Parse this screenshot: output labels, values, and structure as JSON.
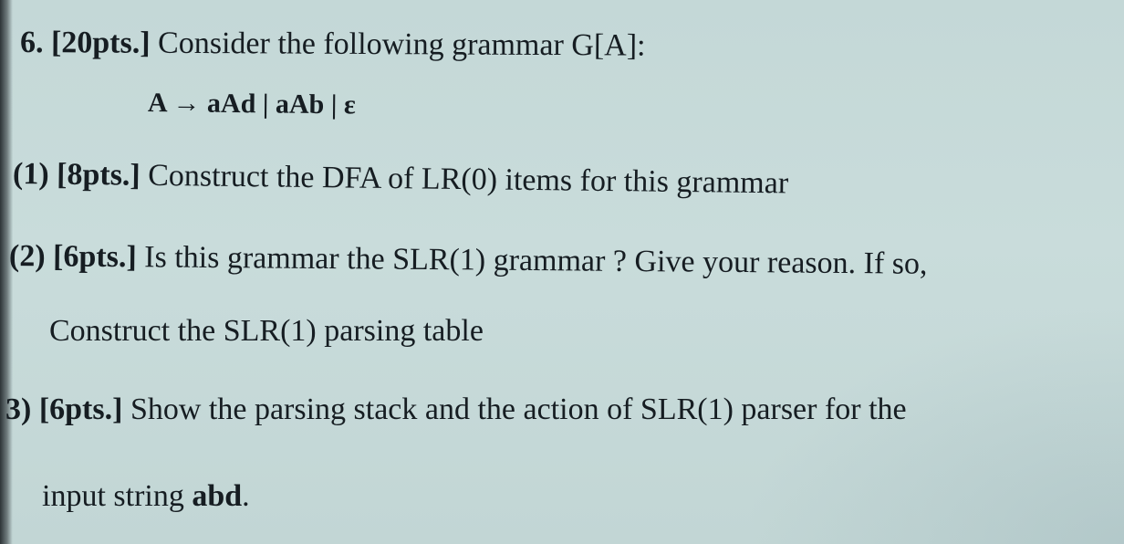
{
  "question": {
    "number_points": "6. [20pts.]",
    "intro": " Consider the following grammar G[A]:",
    "grammar_lhs": "A",
    "grammar_arrow": "→",
    "grammar_rhs": "aAd | aAb | ε"
  },
  "parts": [
    {
      "points": "(1) [8pts.]",
      "text": " Construct the DFA of LR(0) items for this grammar"
    },
    {
      "points": "(2) [6pts.]",
      "text": " Is this grammar the SLR(1) grammar ? Give your reason. If so,",
      "continuation": "Construct the SLR(1) parsing table"
    },
    {
      "points": "3) [6pts.]",
      "text": " Show the parsing stack and the action of SLR(1) parser for the",
      "continuation_prefix": "input string ",
      "continuation_bold": "abd",
      "continuation_suffix": "."
    }
  ]
}
